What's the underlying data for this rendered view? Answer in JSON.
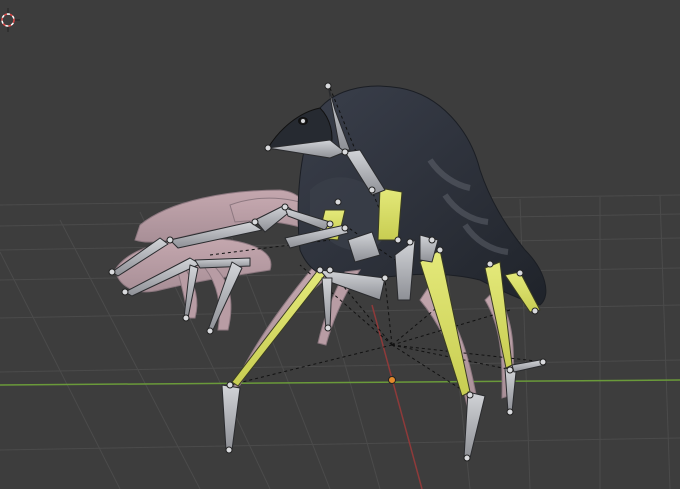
{
  "viewport": {
    "mode": "pose-mode-3d-view",
    "background_color": "#3d3d3d",
    "grid_color": "#4a4a4a",
    "x_axis_color": "#6a9a3a",
    "y_axis_color": "#9a3a3a",
    "selected_bone_color": "#d9df6a",
    "unselected_bone_color": "#b7b9bd",
    "relationship_line_style": "dashed"
  },
  "icons": {
    "cursor": "3d-cursor-icon",
    "origin": "object-origin-icon"
  },
  "scene": {
    "object": "spider-crab-creature-armature",
    "body_color": "#2e3440",
    "leg_color": "#b79aa3"
  }
}
